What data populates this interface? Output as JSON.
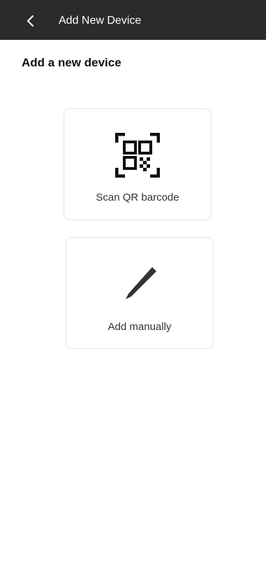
{
  "header": {
    "title": "Add New Device",
    "back_icon": "chevron-left-icon",
    "background": "#2b2b2b"
  },
  "main": {
    "title": "Add a new device",
    "options": [
      {
        "label": "Scan QR barcode",
        "icon": "qr-code-scan-icon"
      },
      {
        "label": "Add manually",
        "icon": "pencil-icon"
      }
    ]
  }
}
